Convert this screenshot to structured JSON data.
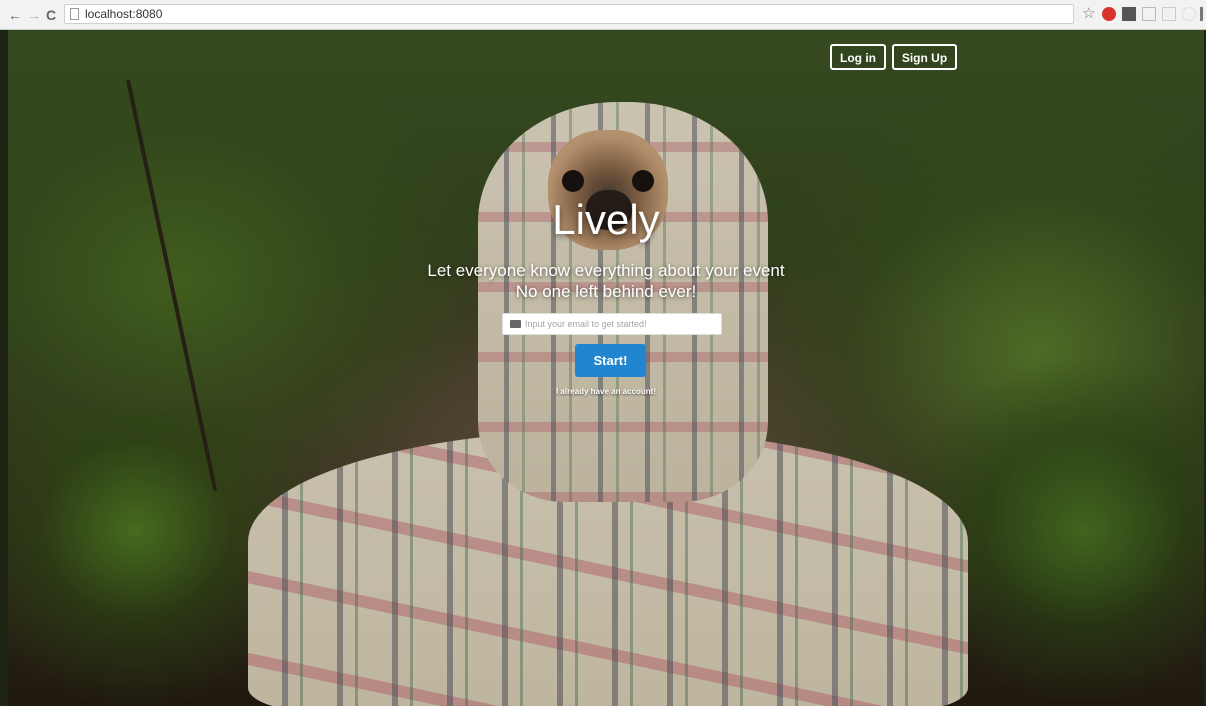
{
  "browser": {
    "back_glyph": "←",
    "forward_glyph": "→",
    "reload_glyph": "C",
    "url": "localhost:8080",
    "star_glyph": "☆"
  },
  "header": {
    "login_label": "Log in",
    "signup_label": "Sign Up"
  },
  "hero": {
    "title": "Lively",
    "tagline_1": "Let everyone know everything about your event",
    "tagline_2": "No one left behind ever!"
  },
  "signup_form": {
    "email_placeholder": "Input your email to get started!",
    "email_value": "",
    "start_label": "Start!",
    "account_link": "I already have an account!"
  },
  "colors": {
    "primary_button": "#2185d0",
    "extension_red": "#d9342b"
  }
}
